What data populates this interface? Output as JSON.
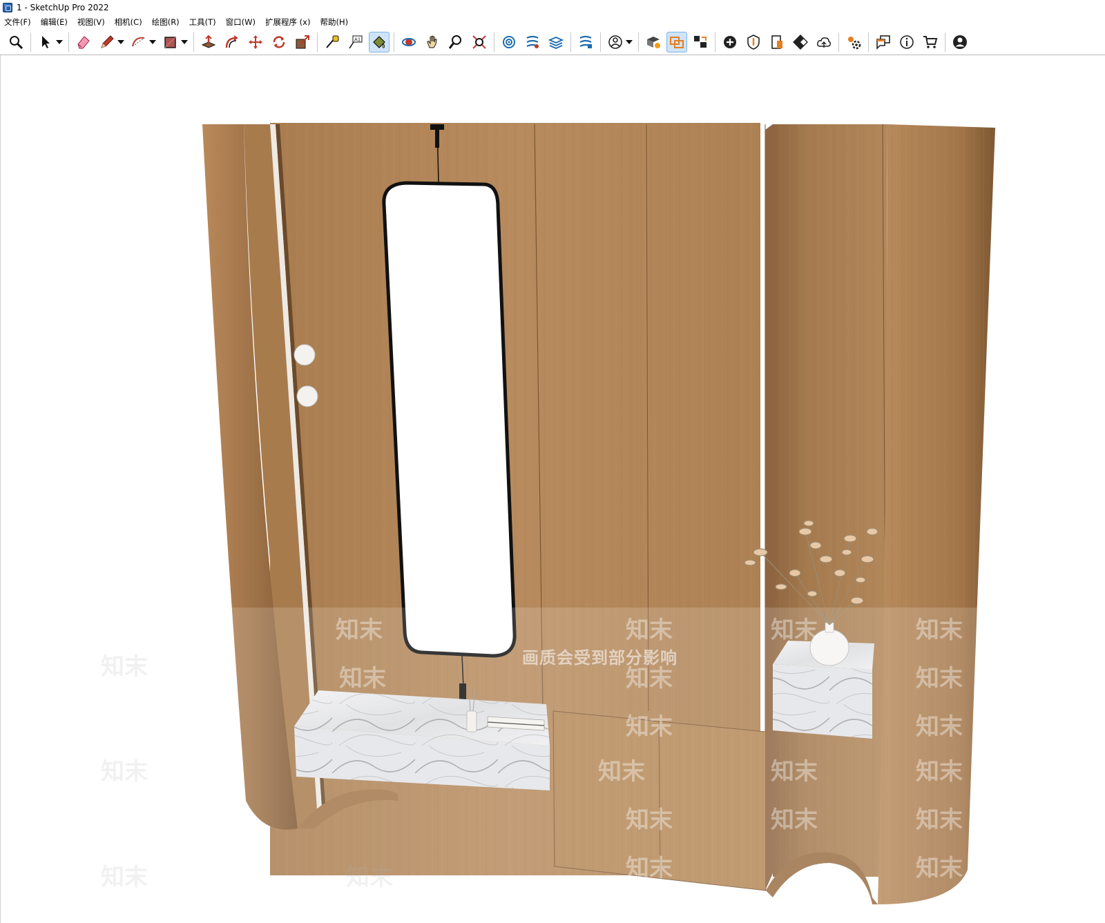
{
  "window": {
    "title": "1 - SketchUp Pro 2022"
  },
  "menu": [
    {
      "label": "文件(F)"
    },
    {
      "label": "编辑(E)"
    },
    {
      "label": "视图(V)"
    },
    {
      "label": "相机(C)"
    },
    {
      "label": "绘图(R)"
    },
    {
      "label": "工具(T)"
    },
    {
      "label": "窗口(W)"
    },
    {
      "label": "扩展程序 (x)"
    },
    {
      "label": "帮助(H)"
    }
  ],
  "toolbar": {
    "tools": [
      "zoom-icon",
      "select-icon",
      "eraser-icon",
      "pencil-icon",
      "arc-icon",
      "rectangle-icon",
      "push-pull-icon",
      "offset-icon",
      "move-icon",
      "rotate-icon",
      "scale-icon",
      "tape-measure-icon",
      "text-icon",
      "paint-bucket-icon",
      "orbit-icon",
      "pan-icon",
      "zoom-window-icon",
      "zoom-extents-icon",
      "warehouse-icon",
      "extension-warehouse-icon",
      "layout-icon",
      "style-builder-icon",
      "profile-icon",
      "solid-tools-icon",
      "section-icon",
      "scenes-icon",
      "add-location-icon",
      "shield-icon",
      "report-icon",
      "checker-icon",
      "cloud-icon",
      "settings-icon",
      "chat-icon",
      "info-icon",
      "cart-icon",
      "account-icon"
    ],
    "active_tool": "paint-bucket-icon"
  },
  "viewport": {
    "watermark_notice": "画质会受到部分影响",
    "watermark_brand": "知末"
  },
  "colors": {
    "wood": "#b08456",
    "wood_dark": "#8f6a44",
    "marble": "#e6e6e8",
    "accent_select": "#cfe4f8"
  }
}
